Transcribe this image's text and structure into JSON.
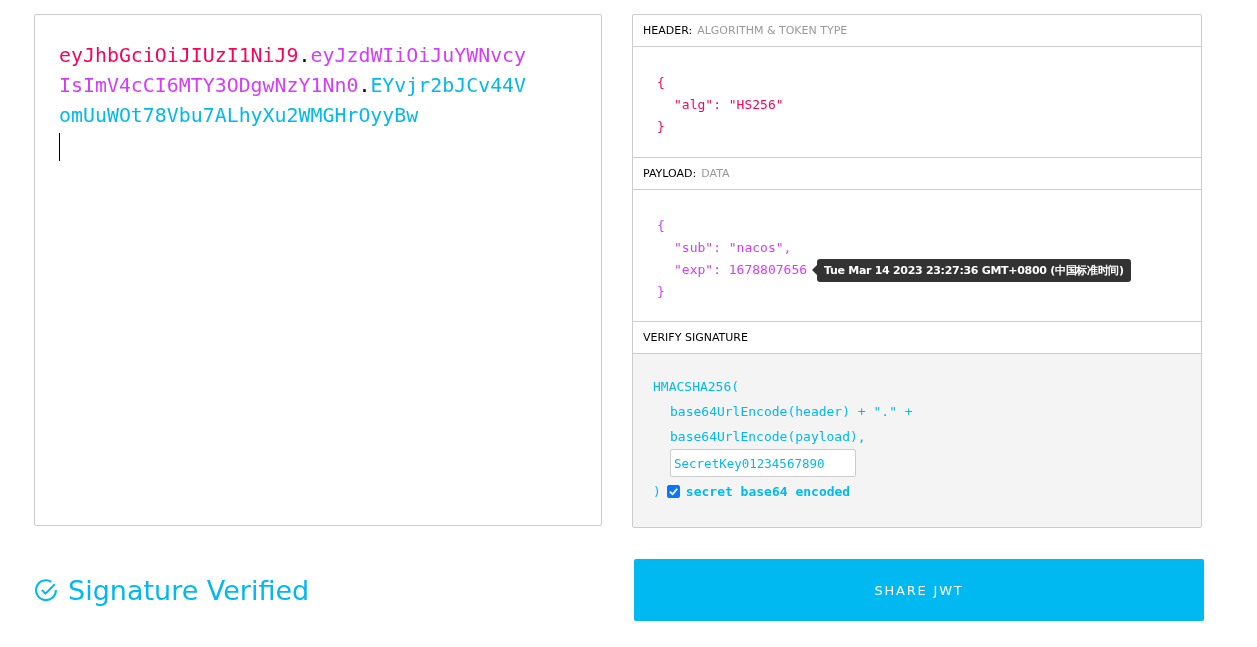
{
  "encoded": {
    "parts": [
      {
        "kind": "header",
        "text": "eyJhbGciOiJIUzI1NiJ9"
      },
      {
        "kind": "dot",
        "text": "."
      },
      {
        "kind": "payload",
        "text": "eyJzdWIiOiJuYWNvcyIsImV4cCI6MTY3ODgwNzY1Nn0"
      },
      {
        "kind": "dot",
        "text": "."
      },
      {
        "kind": "signature",
        "text": "EYvjr2bJCv44VomUuWOt78Vbu7ALhyXu2WMGHrOyyBw"
      }
    ]
  },
  "header": {
    "title": "HEADER:",
    "subtitle": "ALGORITHM & TOKEN TYPE",
    "lines": [
      "{",
      "\"alg\": \"HS256\"",
      "}"
    ]
  },
  "payload": {
    "title": "PAYLOAD:",
    "subtitle": "DATA",
    "lines": [
      "{",
      "\"sub\": \"nacos\",",
      "\"exp\": 1678807656",
      "}"
    ],
    "tooltip": "Tue Mar 14 2023 23:27:36 GMT+0800 (中国标准时间)"
  },
  "verify": {
    "title": "VERIFY SIGNATURE",
    "lines": [
      "HMACSHA256(",
      "base64UrlEncode(header) + \".\" +",
      "base64UrlEncode(payload),"
    ],
    "secret": "SecretKey01234567890",
    "close": ")",
    "base64_checked": true,
    "base64_label": "secret base64 encoded"
  },
  "status": "Signature Verified",
  "share_button": "SHARE JWT"
}
